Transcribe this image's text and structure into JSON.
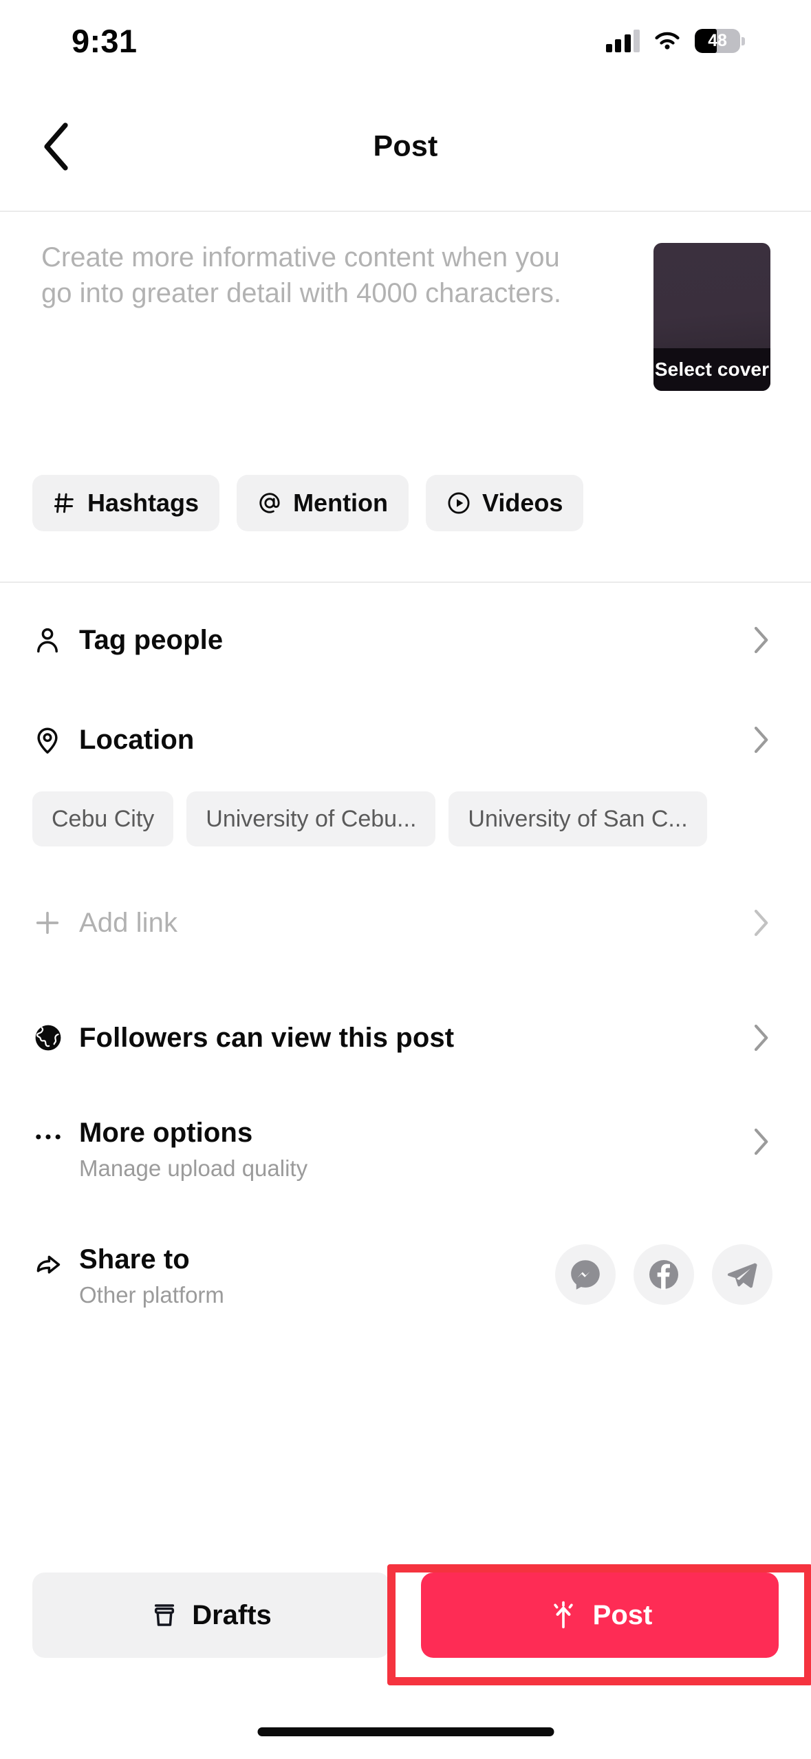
{
  "status_bar": {
    "time": "9:31",
    "battery_percent": "48",
    "battery_level_fraction": 0.48,
    "signal_icon": "cellular-signal-icon",
    "wifi_icon": "wifi-icon",
    "battery_icon": "battery-icon"
  },
  "header": {
    "title": "Post",
    "back_icon": "chevron-left-icon"
  },
  "caption": {
    "placeholder": "Create more informative content when you go into greater detail with 4000 characters.",
    "cover": {
      "label": "Select cover",
      "gradient_top": "#3b303e",
      "gradient_bottom": "#241d27",
      "label_bar_color": "#100c12"
    }
  },
  "quick_chips": [
    {
      "label": "Hashtags",
      "icon": "hashtag-icon"
    },
    {
      "label": "Mention",
      "icon": "at-sign-icon"
    },
    {
      "label": "Videos",
      "icon": "play-circle-icon"
    }
  ],
  "rows": {
    "tag_people": {
      "label": "Tag people",
      "icon": "person-icon",
      "chevron": "chevron-right-icon"
    },
    "location": {
      "label": "Location",
      "icon": "location-pin-icon",
      "chevron": "chevron-right-icon"
    },
    "add_link": {
      "label": "Add link",
      "icon": "plus-icon",
      "chevron": "chevron-right-icon"
    },
    "privacy": {
      "label": "Followers can view this post",
      "icon": "globe-icon",
      "chevron": "chevron-right-icon"
    },
    "more_options": {
      "label": "More options",
      "subtitle": "Manage upload quality",
      "icon": "ellipsis-icon",
      "chevron": "chevron-right-icon"
    },
    "share_to": {
      "label": "Share to",
      "subtitle": "Other platform",
      "icon": "share-arrow-icon"
    }
  },
  "location_suggestions": [
    {
      "label": "Cebu City"
    },
    {
      "label": "University of Cebu..."
    },
    {
      "label": "University of San C..."
    }
  ],
  "share_targets": [
    {
      "name": "messenger-icon"
    },
    {
      "name": "facebook-icon"
    },
    {
      "name": "telegram-icon"
    }
  ],
  "bottom_bar": {
    "drafts_label": "Drafts",
    "drafts_icon": "archive-box-icon",
    "post_label": "Post",
    "post_icon": "sparkle-arrow-up-icon",
    "post_color": "#fe2c55",
    "drafts_color": "#f1f1f2"
  },
  "annotation": {
    "highlight_color": "#f5333f",
    "target": "post-button"
  }
}
